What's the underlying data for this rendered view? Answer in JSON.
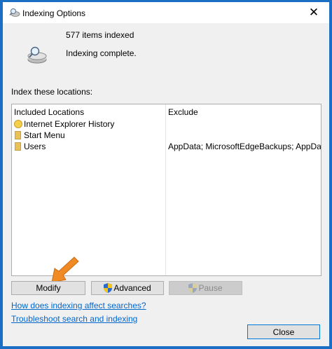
{
  "window": {
    "title": "Indexing Options",
    "close_glyph": "✕"
  },
  "status": {
    "items_indexed": "577 items indexed",
    "state": "Indexing complete.",
    "icon": "indexing-drive-icon"
  },
  "locations": {
    "label": "Index these locations:",
    "columns": [
      "Included Locations",
      "Exclude"
    ],
    "rows": [
      {
        "name": "Internet Explorer History",
        "exclude": "",
        "icon": "ie-history-icon"
      },
      {
        "name": "Start Menu",
        "exclude": "",
        "icon": "folder-icon"
      },
      {
        "name": "Users",
        "exclude": "AppData; MicrosoftEdgeBackups; AppData",
        "icon": "folder-icon"
      }
    ]
  },
  "buttons": {
    "modify": "Modify",
    "advanced": "Advanced",
    "pause": "Pause",
    "close": "Close"
  },
  "links": {
    "how": "How does indexing affect searches?",
    "troubleshoot": "Troubleshoot search and indexing"
  },
  "colors": {
    "accent": "#0078d7",
    "link": "#0066cc",
    "frame": "#1a6fc4",
    "arrow": "#f08a24"
  }
}
